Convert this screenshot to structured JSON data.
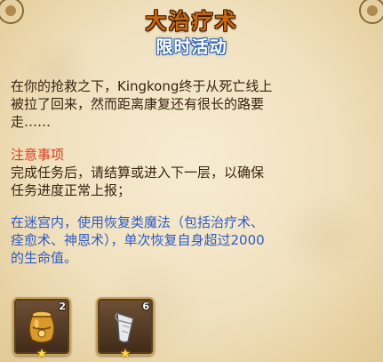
{
  "header": {
    "title": "大治疗术",
    "subtitle": "限时活动"
  },
  "story": {
    "lines": [
      "在你的抢救之下，Kingkong终于从死亡线上",
      "被拉了回来，然而距离康复还有很长的路要",
      "走……"
    ]
  },
  "notice": {
    "title": "注意事项",
    "lines": [
      "完成任务后，请结算或进入下一层，以确保",
      "任务进度正常上报；"
    ]
  },
  "task": {
    "lines": [
      "在迷宫内，使用恢复类魔法（包括治疗术、",
      "痊愈术、神恩术），单次恢复自身超过2000",
      "的生命值。"
    ]
  },
  "rewards": [
    {
      "icon": "golden-jar-icon",
      "count": "2"
    },
    {
      "icon": "scroll-icon",
      "count": "6"
    }
  ],
  "colors": {
    "title": "#c96a12",
    "subtitle_glow": "#2b5fa8",
    "notice_title": "#d83c1c",
    "task_text": "#2f5cc4",
    "body_text": "#3a2412"
  }
}
